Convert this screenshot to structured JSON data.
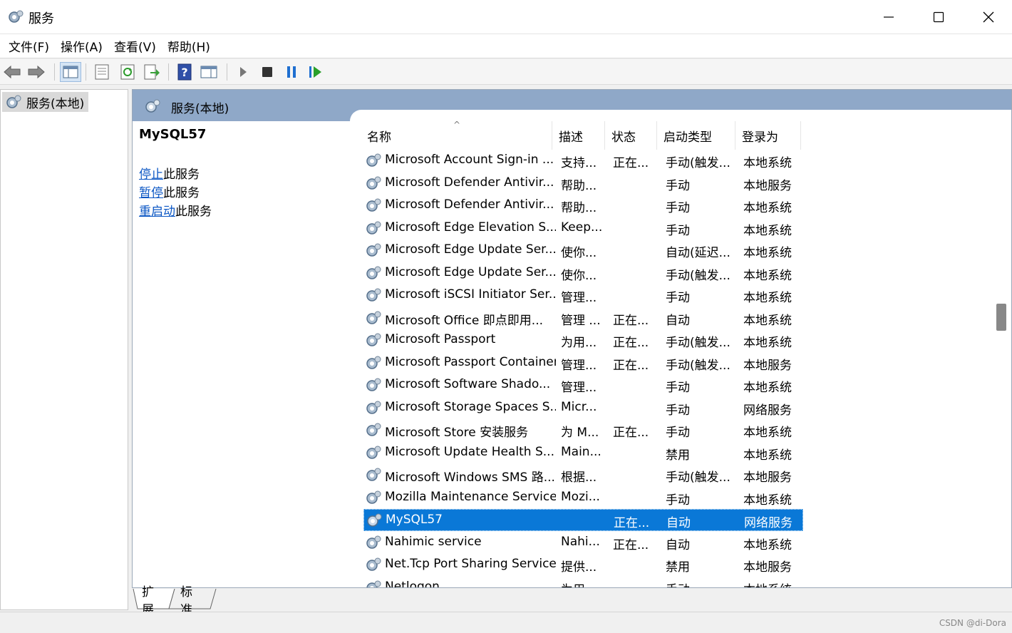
{
  "window": {
    "title": "服务",
    "minimize_icon": "minimize-icon",
    "maximize_icon": "maximize-icon",
    "close_icon": "close-icon"
  },
  "menu": [
    "文件(F)",
    "操作(A)",
    "查看(V)",
    "帮助(H)"
  ],
  "toolbar": [
    "back-arrow-icon",
    "forward-arrow-icon",
    "console-tree-icon",
    "properties-icon",
    "refresh-icon",
    "export-icon",
    "help-icon",
    "action-pane-icon",
    "play-icon",
    "stop-icon",
    "pause-icon",
    "resume-icon"
  ],
  "tree": {
    "root": "服务(本地)"
  },
  "panel": {
    "title": "服务(本地)"
  },
  "detail": {
    "service_name": "MySQL57",
    "stop_link": "停止",
    "stop_suffix": "此服务",
    "pause_link": "暂停",
    "pause_suffix": "此服务",
    "restart_link": "重启动",
    "restart_suffix": "此服务"
  },
  "columns": {
    "name": "名称",
    "desc": "描述",
    "status": "状态",
    "startup": "启动类型",
    "logon": "登录为"
  },
  "rows": [
    {
      "name": "Microsoft Account Sign-in ...",
      "desc": "支持...",
      "status": "正在...",
      "startup": "手动(触发...",
      "logon": "本地系统"
    },
    {
      "name": "Microsoft Defender Antivir...",
      "desc": "帮助...",
      "status": "",
      "startup": "手动",
      "logon": "本地服务"
    },
    {
      "name": "Microsoft Defender Antivir...",
      "desc": "帮助...",
      "status": "",
      "startup": "手动",
      "logon": "本地系统"
    },
    {
      "name": "Microsoft Edge Elevation S...",
      "desc": "Keep...",
      "status": "",
      "startup": "手动",
      "logon": "本地系统"
    },
    {
      "name": "Microsoft Edge Update Ser...",
      "desc": "使你...",
      "status": "",
      "startup": "自动(延迟...",
      "logon": "本地系统"
    },
    {
      "name": "Microsoft Edge Update Ser...",
      "desc": "使你...",
      "status": "",
      "startup": "手动(触发...",
      "logon": "本地系统"
    },
    {
      "name": "Microsoft iSCSI Initiator Ser...",
      "desc": "管理...",
      "status": "",
      "startup": "手动",
      "logon": "本地系统"
    },
    {
      "name": "Microsoft Office 即点即用...",
      "desc": "管理 ...",
      "status": "正在...",
      "startup": "自动",
      "logon": "本地系统"
    },
    {
      "name": "Microsoft Passport",
      "desc": "为用...",
      "status": "正在...",
      "startup": "手动(触发...",
      "logon": "本地系统"
    },
    {
      "name": "Microsoft Passport Container",
      "desc": "管理...",
      "status": "正在...",
      "startup": "手动(触发...",
      "logon": "本地服务"
    },
    {
      "name": "Microsoft Software Shado...",
      "desc": "管理...",
      "status": "",
      "startup": "手动",
      "logon": "本地系统"
    },
    {
      "name": "Microsoft Storage Spaces S...",
      "desc": "Micr...",
      "status": "",
      "startup": "手动",
      "logon": "网络服务"
    },
    {
      "name": "Microsoft Store 安装服务",
      "desc": "为 M...",
      "status": "正在...",
      "startup": "手动",
      "logon": "本地系统"
    },
    {
      "name": "Microsoft Update Health S...",
      "desc": "Main...",
      "status": "",
      "startup": "禁用",
      "logon": "本地系统"
    },
    {
      "name": "Microsoft Windows SMS 路...",
      "desc": "根据...",
      "status": "",
      "startup": "手动(触发...",
      "logon": "本地服务"
    },
    {
      "name": "Mozilla Maintenance Service",
      "desc": "Mozi...",
      "status": "",
      "startup": "手动",
      "logon": "本地系统"
    },
    {
      "name": "MySQL57",
      "desc": "",
      "status": "正在...",
      "startup": "自动",
      "logon": "网络服务",
      "selected": true
    },
    {
      "name": "Nahimic service",
      "desc": "Nahi...",
      "status": "正在...",
      "startup": "自动",
      "logon": "本地系统"
    },
    {
      "name": "Net.Tcp Port Sharing Service",
      "desc": "提供...",
      "status": "",
      "startup": "禁用",
      "logon": "本地服务"
    },
    {
      "name": "Netlogon",
      "desc": "为用...",
      "status": "",
      "startup": "手动",
      "logon": "本地系统"
    }
  ],
  "tabs": {
    "extended": "扩展",
    "standard": "标准"
  },
  "watermark": "CSDN @di-Dora",
  "colors": {
    "selection": "#0a78d7",
    "header": "#8fa8c8",
    "link": "#0a56c4"
  }
}
